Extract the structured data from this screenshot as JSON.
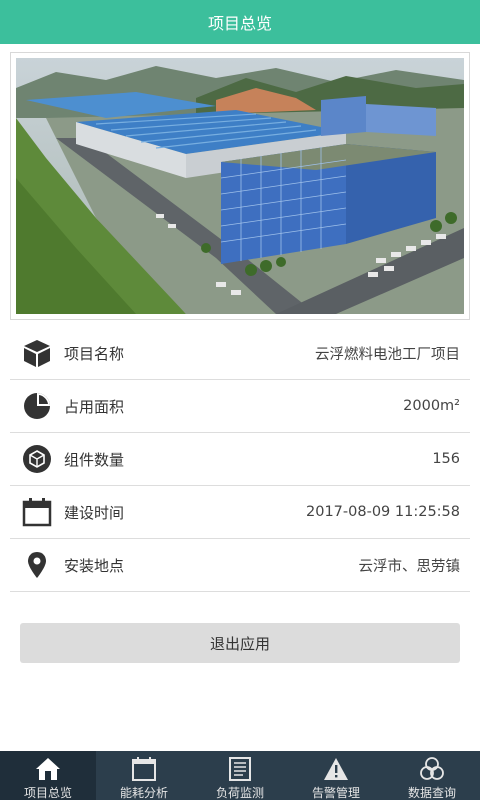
{
  "header": {
    "title": "项目总览"
  },
  "photo": {
    "alt": "factory-aerial-photo"
  },
  "info": [
    {
      "icon": "cube-icon",
      "label": "项目名称",
      "value": "云浮燃料电池工厂项目"
    },
    {
      "icon": "pie-chart-icon",
      "label": "占用面积",
      "value": "2000m²"
    },
    {
      "icon": "component-icon",
      "label": "组件数量",
      "value": "156"
    },
    {
      "icon": "calendar-icon",
      "label": "建设时间",
      "value": "2017-08-09 11:25:58"
    },
    {
      "icon": "location-pin-icon",
      "label": "安装地点",
      "value": "云浮市、思劳镇"
    }
  ],
  "exit_button": {
    "label": "退出应用"
  },
  "tabs": [
    {
      "icon": "home-icon",
      "label": "项目总览",
      "active": true
    },
    {
      "icon": "calendar-icon",
      "label": "能耗分析",
      "active": false
    },
    {
      "icon": "document-icon",
      "label": "负荷监测",
      "active": false
    },
    {
      "icon": "warning-icon",
      "label": "告警管理",
      "active": false
    },
    {
      "icon": "circles-icon",
      "label": "数据查询",
      "active": false
    }
  ],
  "colors": {
    "header": "#3cbf9c",
    "tabbar": "#2c3e4c",
    "button": "#dcdcdc"
  }
}
